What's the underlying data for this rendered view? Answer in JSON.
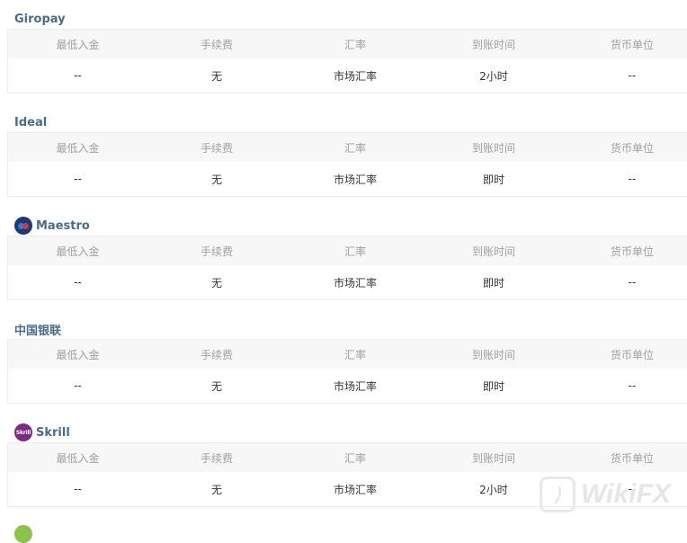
{
  "columns": [
    "最低入金",
    "手续费",
    "汇率",
    "到账时间",
    "货币单位"
  ],
  "methods": [
    {
      "title": "Giropay",
      "logo": "",
      "values": [
        "--",
        "无",
        "市场汇率",
        "2小时",
        "--"
      ]
    },
    {
      "title": "Ideal",
      "logo": "",
      "values": [
        "--",
        "无",
        "市场汇率",
        "即时",
        "--"
      ]
    },
    {
      "title": "Maestro",
      "logo": "maestro-logo",
      "values": [
        "--",
        "无",
        "市场汇率",
        "即时",
        "--"
      ]
    },
    {
      "title": "中国银联",
      "logo": "",
      "values": [
        "--",
        "无",
        "市场汇率",
        "即时",
        "--"
      ]
    },
    {
      "title": "Skrill",
      "logo_text": "Skrill",
      "values": [
        "--",
        "无",
        "市场汇率",
        "2小时",
        "--"
      ]
    }
  ],
  "watermark": {
    "text": "WikiFX"
  },
  "colors": {
    "title": "#4a6c8c",
    "header_bg": "#f7f7f7",
    "header_text": "#a0a0a0",
    "border": "#ececec"
  }
}
